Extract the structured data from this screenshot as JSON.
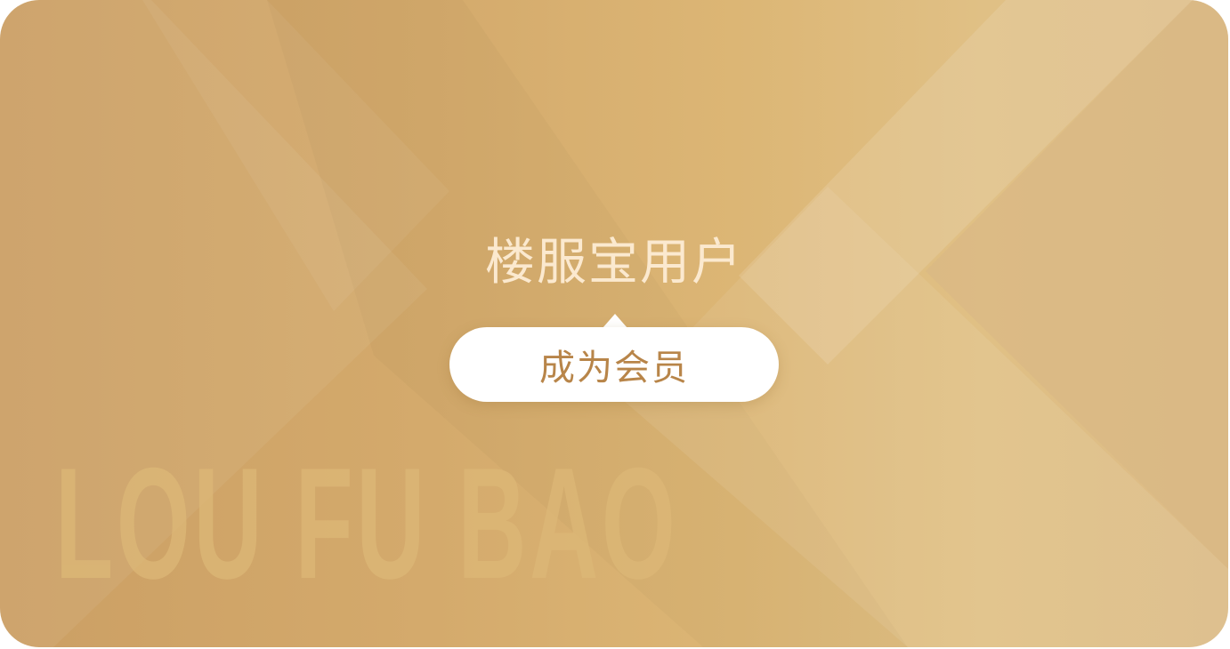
{
  "card": {
    "title": "楼服宝用户",
    "watermark": "LOU FU BAO",
    "cta_label": "成为会员"
  },
  "colors": {
    "background_start": "#cb9f64",
    "background_end": "#e0c085",
    "title": "#fbe9cf",
    "cta_text": "#b88549",
    "cta_bg": "#ffffff"
  }
}
